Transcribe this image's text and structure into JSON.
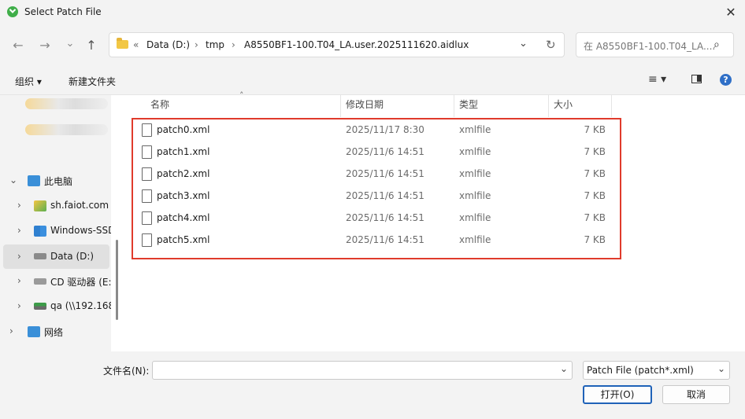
{
  "window": {
    "title": "Select Patch File",
    "close_glyph": "✕"
  },
  "nav": {
    "back_glyph": "←",
    "forward_glyph": "→",
    "recent_glyph": "⌄",
    "up_glyph": "↑",
    "breadcrumb": [
      "«",
      "Data (D:)",
      "›",
      "tmp",
      "›",
      "A8550BF1-100.T04_LA.user.2025111620.aidlux"
    ],
    "dropdown_glyph": "⌄",
    "refresh_glyph": "↻"
  },
  "search": {
    "placeholder": "在 A8550BF1-100.T04_LA....",
    "icon_glyph": "⌕"
  },
  "toolbar": {
    "organize": "组织 ▾",
    "new_folder": "新建文件夹",
    "view_glyph": "≡ ▾",
    "pane_glyph": "▮",
    "help_glyph": "?"
  },
  "sidebar": {
    "items": [
      {
        "label": "此电脑",
        "arrow": "⌄"
      },
      {
        "label": "sh.faiot.com",
        "arrow": "›"
      },
      {
        "label": "Windows-SSD",
        "arrow": "›"
      },
      {
        "label": "Data (D:)",
        "arrow": "›"
      },
      {
        "label": "CD 驱动器 (E:",
        "arrow": "›"
      },
      {
        "label": "qa (\\\\192.168",
        "arrow": "›"
      },
      {
        "label": "网络",
        "arrow": "›"
      }
    ]
  },
  "filelist": {
    "sort_glyph": "˄",
    "columns": [
      "名称",
      "修改日期",
      "类型",
      "大小"
    ],
    "rows": [
      {
        "name": "patch0.xml",
        "date": "2025/11/17 8:30",
        "type": "xmlfile",
        "size": "7 KB"
      },
      {
        "name": "patch1.xml",
        "date": "2025/11/6 14:51",
        "type": "xmlfile",
        "size": "7 KB"
      },
      {
        "name": "patch2.xml",
        "date": "2025/11/6 14:51",
        "type": "xmlfile",
        "size": "7 KB"
      },
      {
        "name": "patch3.xml",
        "date": "2025/11/6 14:51",
        "type": "xmlfile",
        "size": "7 KB"
      },
      {
        "name": "patch4.xml",
        "date": "2025/11/6 14:51",
        "type": "xmlfile",
        "size": "7 KB"
      },
      {
        "name": "patch5.xml",
        "date": "2025/11/6 14:51",
        "type": "xmlfile",
        "size": "7 KB"
      }
    ]
  },
  "bottom": {
    "filename_label": "文件名(N):",
    "filename_value": "",
    "filter_value": "Patch File (patch*.xml)",
    "open_label": "打开(O)",
    "cancel_label": "取消",
    "dropdown_glyph": "⌄"
  },
  "colors": {
    "highlight": "#e03b2c",
    "selected_row": "#e0e0e0",
    "folder": "#f2c744"
  }
}
